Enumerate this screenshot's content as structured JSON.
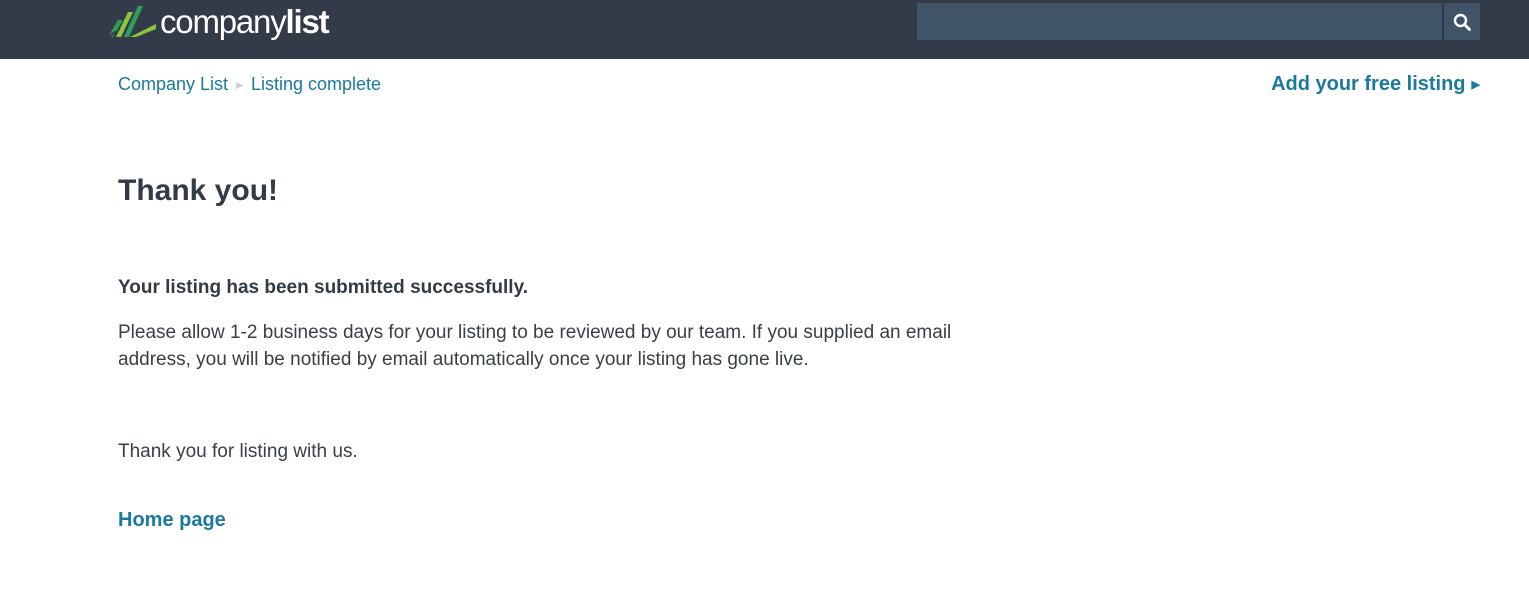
{
  "header": {
    "logo": {
      "text_regular": "company",
      "text_bold": "list"
    },
    "search": {
      "placeholder": "",
      "value": "",
      "icon": "search-icon"
    }
  },
  "breadcrumb": {
    "items": [
      "Company List",
      "Listing complete"
    ]
  },
  "add_listing": {
    "label": "Add your free listing"
  },
  "content": {
    "title": "Thank you!",
    "subhead": "Your listing has been submitted successfully.",
    "body": "Please allow 1-2 business days for your listing to be reviewed by our team. If you supplied an email address, you will be notified by email automatically once your listing has gone live.",
    "thanks": "Thank you for listing with us.",
    "home_link": "Home page"
  },
  "colors": {
    "header_bg": "#343b48",
    "search_bg": "#3f5567",
    "link": "#1a7a9c",
    "logo_green_light": "#8cc63f",
    "logo_green_dark": "#2e9e5b"
  }
}
